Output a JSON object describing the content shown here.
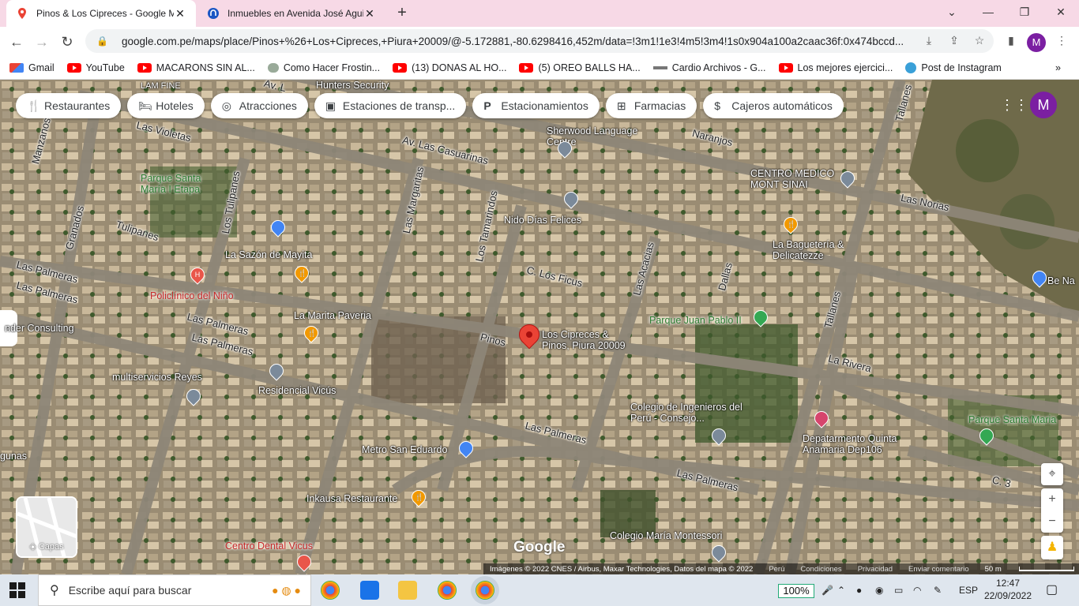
{
  "browser": {
    "tabs": [
      {
        "title": "Pinos & Los Cipreces - Google M",
        "active": true,
        "icon": "google-maps-icon"
      },
      {
        "title": "Inmuebles en Avenida José Aguil",
        "active": false,
        "icon": "site-favicon"
      }
    ],
    "url": "google.com.pe/maps/place/Pinos+%26+Los+Cipreces,+Piura+20009/@-5.172881,-80.6298416,452m/data=!3m1!1e3!4m5!3m4!1s0x904a100a2caac36f:0x474bccd...",
    "profile_initial": "M",
    "bookmarks": [
      {
        "label": "Gmail",
        "icon": "gmail-icon"
      },
      {
        "label": "YouTube",
        "icon": "youtube-icon"
      },
      {
        "label": "MACARONS SIN AL...",
        "icon": "youtube-icon"
      },
      {
        "label": "Como Hacer Frostin...",
        "icon": "site-icon"
      },
      {
        "label": "(13) DONAS AL HO...",
        "icon": "youtube-icon"
      },
      {
        "label": "(5) OREO BALLS HA...",
        "icon": "youtube-icon"
      },
      {
        "label": "Cardio Archivos - G...",
        "icon": "gym-icon"
      },
      {
        "label": "Los mejores ejercici...",
        "icon": "youtube-icon"
      },
      {
        "label": "Post de Instagram",
        "icon": "canva-icon"
      }
    ]
  },
  "maps": {
    "chips": [
      {
        "label": "Restaurantes",
        "icon": "fork-knife-icon"
      },
      {
        "label": "Hoteles",
        "icon": "bed-icon"
      },
      {
        "label": "Atracciones",
        "icon": "camera-icon"
      },
      {
        "label": "Estaciones de transp...",
        "icon": "bus-icon"
      },
      {
        "label": "Estacionamientos",
        "icon": "parking-icon"
      },
      {
        "label": "Farmacias",
        "icon": "pharmacy-icon"
      },
      {
        "label": "Cajeros automáticos",
        "icon": "atm-icon"
      }
    ],
    "profile_initial": "M",
    "layers_label": "Capas",
    "logo": "Google",
    "selected_place": "Los Cipreces & Pinos, Piura 20009",
    "selected_place_line1": "Los Cipreces &",
    "selected_place_line2": "Pinos, Piura 20009",
    "roads": [
      "Av. Las Casuarinas",
      "Las Violetas",
      "Manzanos",
      "Granados",
      "Tulipanes",
      "Los Tulipanes",
      "Las Margaritas",
      "Los Tamarindos",
      "C. Los Ficus",
      "Las Acacias",
      "Dallas",
      "Naranjos",
      "Las Norias",
      "Tallanes",
      "La Rivera",
      "Las Palmeras",
      "Pinos",
      "C. 3",
      "Av. L"
    ],
    "places": [
      {
        "name": "Hunters Security",
        "pin": "gray"
      },
      {
        "name": "Sherwood Language Centre",
        "pin": "gray"
      },
      {
        "name": "Nido Días Felices",
        "pin": "gray"
      },
      {
        "name": "CENTRO MEDICO MONT SINAI",
        "pin": "gray"
      },
      {
        "name": "La Baguetería & Delicatezze",
        "pin": "orange"
      },
      {
        "name": "Parque Santa María I Etapa",
        "pin": "green"
      },
      {
        "name": "La Sazón de Mayita",
        "pin": "orange"
      },
      {
        "name": "Policlínico del Niño",
        "pin": "red"
      },
      {
        "name": "La Marita Paveria",
        "pin": "orange"
      },
      {
        "name": "Parque Juan Pablo II",
        "pin": "green"
      },
      {
        "name": "multiservicios Reyes",
        "pin": "gray"
      },
      {
        "name": "Residencial Vicús",
        "pin": "gray"
      },
      {
        "name": "Colegio de Ingenieros del Perú - Consejo...",
        "pin": "gray"
      },
      {
        "name": "Depatarmento Quinta Anamaria Dep106",
        "pin": "pink"
      },
      {
        "name": "Parque Santa Maria",
        "pin": "green"
      },
      {
        "name": "Metro San Eduardo",
        "pin": "blue"
      },
      {
        "name": "Inkausa Restaurante",
        "pin": "orange"
      },
      {
        "name": "Centro Dental Vicus",
        "pin": "red"
      },
      {
        "name": "Colegio María Montessori",
        "pin": "gray"
      },
      {
        "name": "nder Consulting",
        "pin": "gray"
      },
      {
        "name": "gunas",
        "pin": "none"
      },
      {
        "name": "Be Na",
        "pin": "blue"
      },
      {
        "name": "LAM FINE",
        "pin": "none"
      }
    ],
    "attribution": "Imágenes © 2022 CNES / Airbus, Maxar Technologies, Datos del mapa © 2022",
    "attr_links": [
      "Perú",
      "Condiciones",
      "Privacidad",
      "Enviar comentario"
    ],
    "scale": "50 m"
  },
  "taskbar": {
    "search_placeholder": "Escribe aquí para buscar",
    "battery": "100%",
    "lang": "ESP",
    "time": "12:47",
    "date": "22/09/2022"
  }
}
